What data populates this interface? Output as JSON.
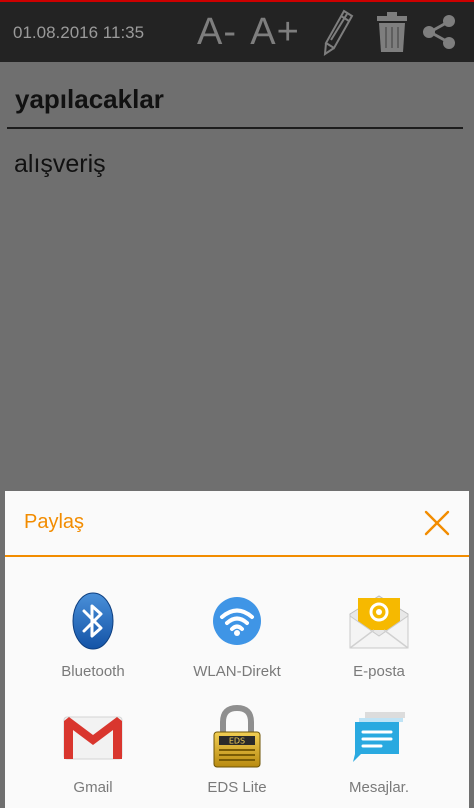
{
  "topbar": {
    "datetime": "01.08.2016 11:35",
    "font_decrease_label": "A-",
    "font_increase_label": "A+",
    "icons": [
      "pencil-icon",
      "trash-icon",
      "share-icon"
    ]
  },
  "note": {
    "title": "yapılacaklar",
    "body": "alışveriş"
  },
  "share_sheet": {
    "title": "Paylaş",
    "accent_color": "#f28c00",
    "apps": [
      {
        "label": "Bluetooth",
        "icon": "bluetooth-icon"
      },
      {
        "label": "WLAN-Direkt",
        "icon": "wifi-direct-icon"
      },
      {
        "label": "E-posta",
        "icon": "email-icon"
      },
      {
        "label": "Gmail",
        "icon": "gmail-icon"
      },
      {
        "label": "EDS Lite",
        "icon": "eds-lite-icon"
      },
      {
        "label": "Mesajlar.",
        "icon": "messages-icon"
      }
    ]
  }
}
